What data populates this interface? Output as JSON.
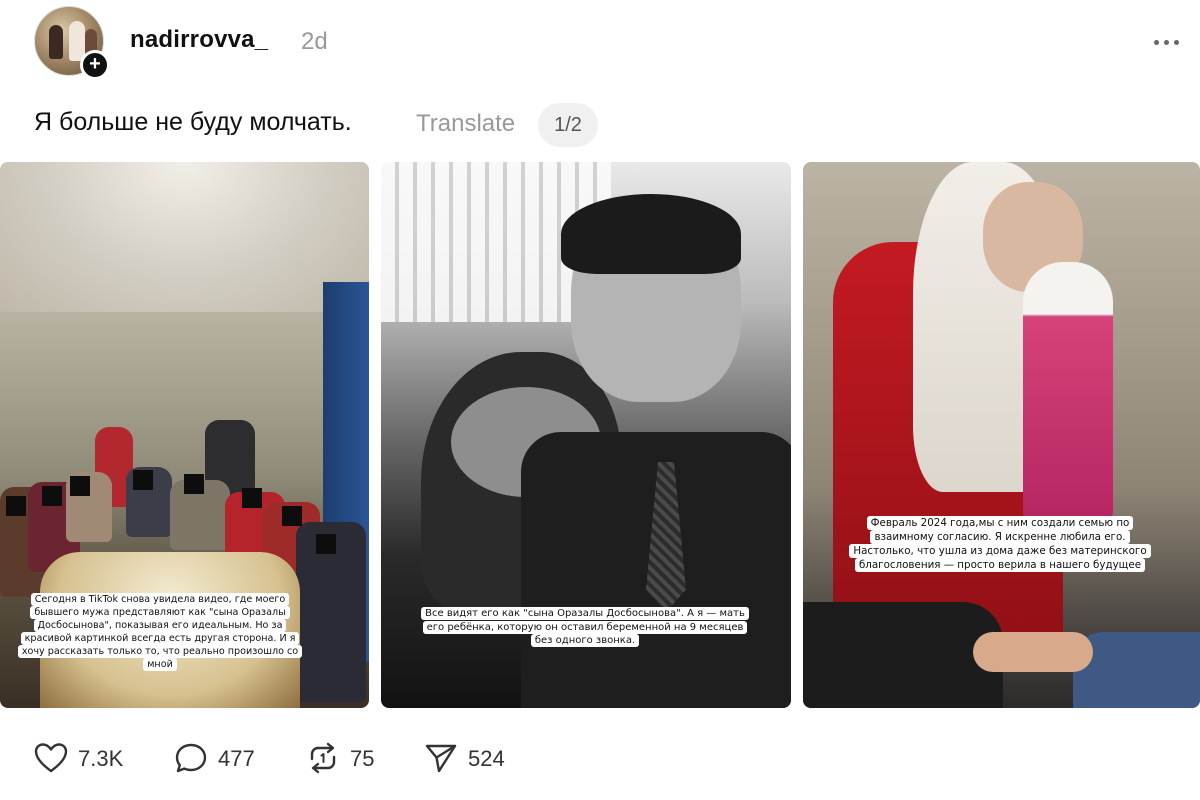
{
  "post": {
    "username": "nadirrovva_",
    "timestamp": "2d",
    "caption": "Я больше не буду молчать.",
    "translate_label": "Translate",
    "pager": "1/2"
  },
  "images": [
    {
      "overlay_text": "Сегодня в TikTok снова увидела видео, где моего бывшего мужа представляют как \"сына Оразалы Досбосынова\", показывая его идеальным. Но за красивой картинкой всегда есть другая сторона. И я хочу рассказать только то, что реально произошло со мной"
    },
    {
      "overlay_text": "Все видят его как \"сына Оразалы Досбосынова\". А я — мать его ребёнка, которую он оставил беременной на 9 месяцев без одного звонка."
    },
    {
      "overlay_text": "Февраль 2024 года,мы с ним создали семью по взаимному согласию. Я искренне любила его. Настолько, что ушла из дома даже без материнского благословения — просто верила в нашего будущее"
    }
  ],
  "actions": {
    "likes": "7.3K",
    "comments": "477",
    "reposts": "75",
    "shares": "524"
  },
  "icons": {
    "like": "heart-icon",
    "comment": "comment-bubble-icon",
    "repost": "repost-icon",
    "share": "send-icon",
    "more": "more-horizontal-icon",
    "follow": "plus-icon"
  }
}
